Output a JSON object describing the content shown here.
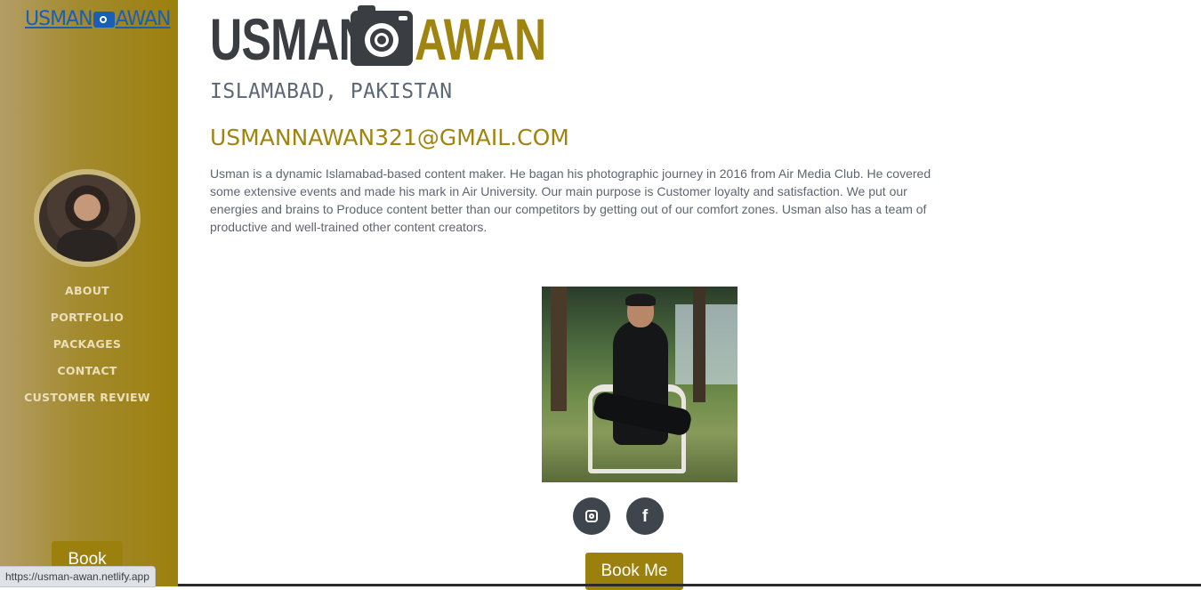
{
  "colors": {
    "accent": "#9c800d",
    "dark": "#3a3d42",
    "link": "#1a5fb4"
  },
  "sidebar": {
    "logo_left": "USMAN",
    "logo_icon": "camera-icon",
    "logo_right": "AWAN",
    "avatar": "profile-avatar",
    "nav": [
      {
        "label": "ABOUT"
      },
      {
        "label": "PORTFOLIO"
      },
      {
        "label": "PACKAGES"
      },
      {
        "label": "CONTACT"
      },
      {
        "label": "CUSTOMER REVIEW"
      }
    ],
    "book_label": "Book"
  },
  "status_bar": {
    "url": "https://usman-awan.netlify.app"
  },
  "main": {
    "brand_first": "USMAN",
    "brand_icon": "camera-icon",
    "brand_second": "AWAN",
    "city": "ISLAMABAD, PAKISTAN",
    "email": "USMANNAWAN321@GMAIL.COM",
    "bio": "Usman is a dynamic Islamabad-based content maker. He bagan his photographic journey in 2016 from Air Media Club. He covered some extensive events and made his mark in Air University. Our main purpose is Customer loyalty and satisfaction. We put our energies and brains to Produce content better than our competitors by getting out of our comfort zones. Usman also has a team of productive and well-trained other content creators.",
    "social": [
      {
        "icon": "instagram-icon"
      },
      {
        "icon": "facebook-icon",
        "glyph": "f"
      }
    ],
    "book_me_label": "Book Me"
  }
}
